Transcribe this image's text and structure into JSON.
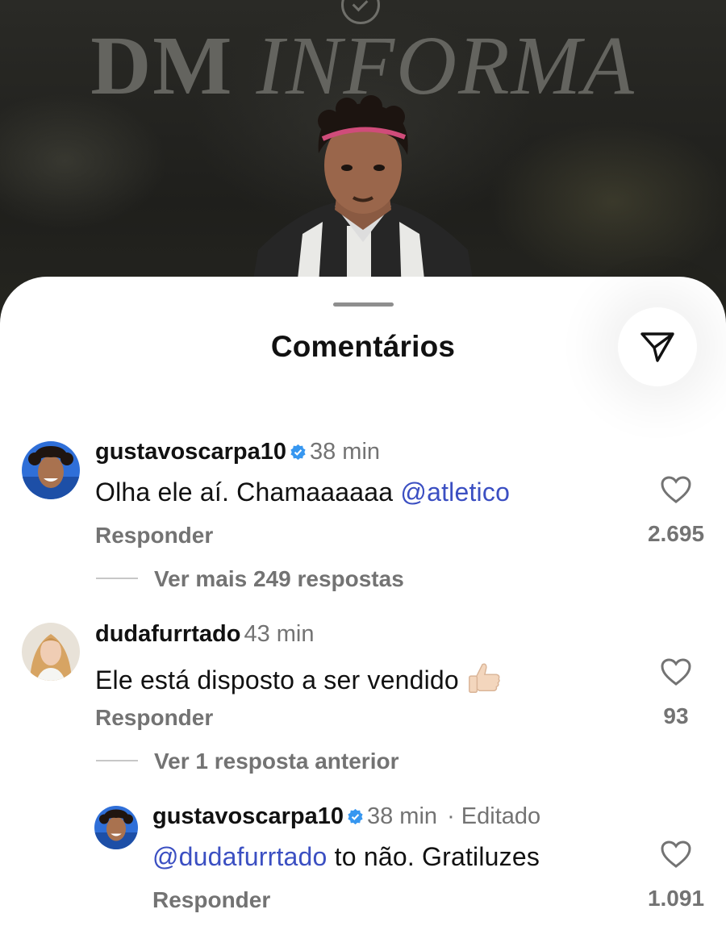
{
  "post": {
    "brand_left": "DM",
    "brand_right": "INFORMA"
  },
  "sheet": {
    "title": "Comentários"
  },
  "comments": [
    {
      "username": "gustavoscarpa10",
      "verified": true,
      "time": "38 min",
      "mention": "@atletico",
      "text": "Olha ele aí. Chamaaaaaa",
      "reply_label": "Responder",
      "likes": "2.695",
      "more_replies": "Ver mais 249 respostas"
    },
    {
      "username": "dudafurrtado",
      "verified": false,
      "time": "43 min",
      "text": "Ele está disposto a ser vendido",
      "emoji": "thumbs-up-icon",
      "reply_label": "Responder",
      "likes": "93",
      "more_replies": "Ver 1 resposta anterior"
    }
  ],
  "reply": {
    "username": "gustavoscarpa10",
    "verified": true,
    "time": "38 min",
    "edited": "· Editado",
    "mention": "@dudafurrtado",
    "text": "to não. Gratiluzes",
    "reply_label": "Responder",
    "likes": "1.091"
  },
  "colors": {
    "mention": "#3b4fc2",
    "verified": "#3797f0",
    "muted_text": "#737373"
  }
}
